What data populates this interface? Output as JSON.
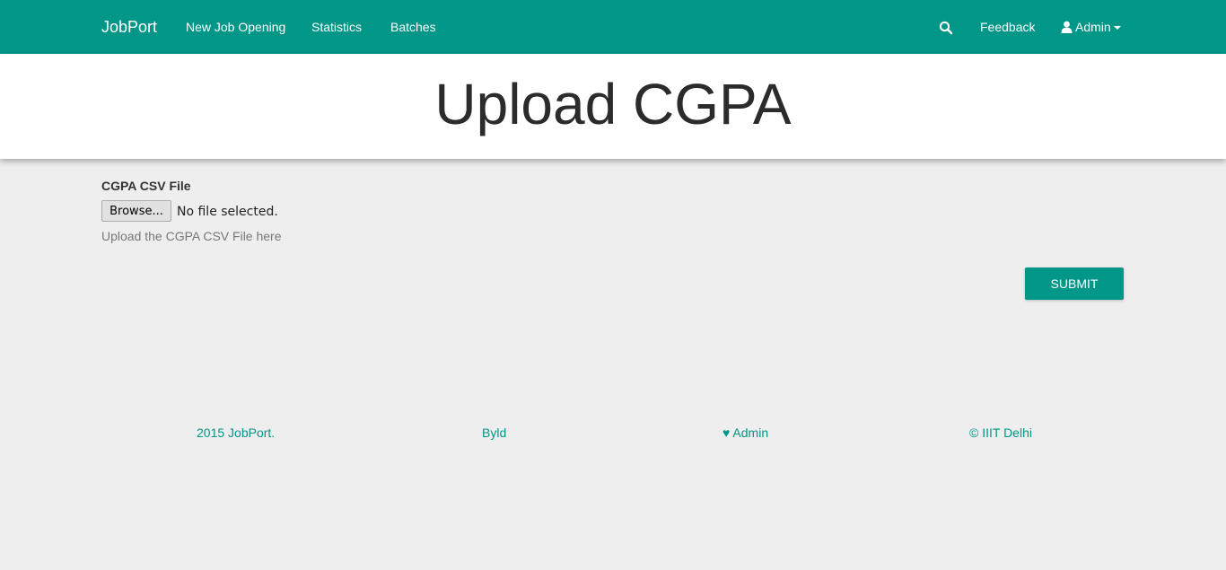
{
  "navbar": {
    "brand": "JobPort",
    "links": [
      "New Job Opening",
      "Statistics",
      "Batches"
    ],
    "feedback": "Feedback",
    "user": "Admin",
    "accent_color": "#009688"
  },
  "header": {
    "title": "Upload CGPA"
  },
  "form": {
    "label": "CGPA CSV File",
    "browse_label": "Browse...",
    "file_status": "No file selected.",
    "help_text": "Upload the CGPA CSV File here",
    "submit_label": "SUBMIT"
  },
  "footer": {
    "items": [
      "2015 JobPort.",
      "Byld",
      "♥ Admin",
      "© IIIT Delhi"
    ]
  },
  "icons": {
    "search": "search-icon",
    "user": "user-icon",
    "dropdown": "caret-down-icon"
  }
}
